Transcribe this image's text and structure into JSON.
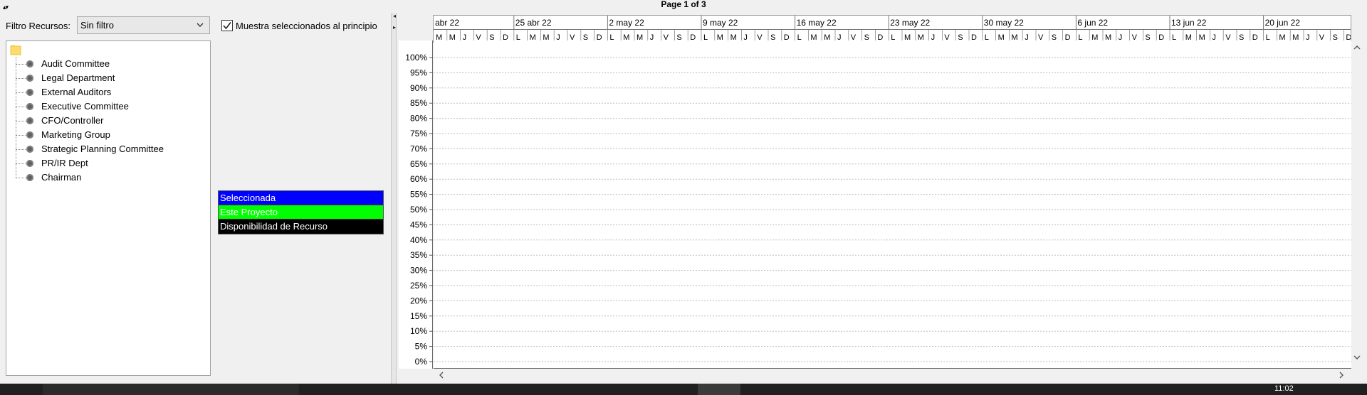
{
  "page_label": "Page 1 of 3",
  "filter": {
    "label": "Filtro Recursos:",
    "selected": "Sin filtro"
  },
  "show_selected_first": {
    "label": "Muestra seleccionados al principio",
    "checked": true
  },
  "resources": [
    "Audit Committee",
    "Legal Department",
    "External Auditors",
    "Executive Committee",
    "CFO/Controller",
    "Marketing Group",
    "Strategic Planning Committee",
    "PR/IR Dept",
    "Chairman"
  ],
  "legend": [
    {
      "label": "Seleccionada",
      "color": "#0000ff",
      "text_color": "#ffffff"
    },
    {
      "label": "Este Proyecto",
      "color": "#00ff00",
      "text_color": "#ffffff"
    },
    {
      "label": "Disponibilidad de Recurso",
      "color": "#000000",
      "text_color": "#ffffff"
    }
  ],
  "timescale": {
    "weeks": [
      "abr 22",
      "25 abr 22",
      "2 may 22",
      "9 may 22",
      "16 may 22",
      "23 may 22",
      "30 may 22",
      "6 jun 22",
      "13 jun 22",
      "20 jun 22"
    ],
    "first_week_days": [
      "M",
      "M",
      "J",
      "V",
      "S",
      "D"
    ],
    "days": [
      "L",
      "M",
      "M",
      "J",
      "V",
      "S",
      "D"
    ]
  },
  "y_axis": {
    "ticks": [
      "100%",
      "95%",
      "90%",
      "85%",
      "80%",
      "75%",
      "70%",
      "65%",
      "60%",
      "55%",
      "50%",
      "45%",
      "40%",
      "35%",
      "30%",
      "25%",
      "20%",
      "15%",
      "10%",
      "5%",
      "0%"
    ]
  },
  "chart_data": {
    "type": "bar",
    "title": "",
    "xlabel": "",
    "ylabel": "",
    "categories": [
      "abr 22",
      "25 abr 22",
      "2 may 22",
      "9 may 22",
      "16 may 22",
      "23 may 22",
      "30 may 22",
      "6 jun 22",
      "13 jun 22",
      "20 jun 22"
    ],
    "series": [],
    "ylim": [
      0,
      100
    ],
    "y_unit": "%",
    "grid": true
  },
  "taskbar": {
    "clock": "11:02"
  }
}
